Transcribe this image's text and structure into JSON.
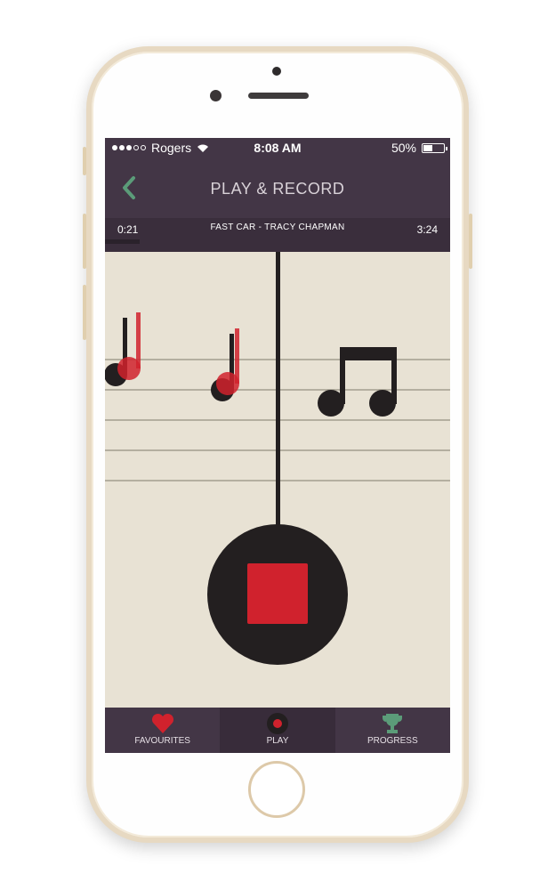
{
  "status_bar": {
    "carrier": "Rogers",
    "time": "8:08 AM",
    "battery_percent": "50%",
    "battery_level": 0.5
  },
  "nav": {
    "title": "PLAY & RECORD",
    "back_icon": "chevron-left-icon"
  },
  "track": {
    "current_time": "0:21",
    "name": "FAST CAR - TRACY CHAPMAN",
    "total_time": "3:24",
    "progress": 0.1
  },
  "colors": {
    "header": "#433646",
    "accent_red": "#d0222d",
    "back_green": "#5b9c79",
    "paper": "#e8e2d4",
    "ink": "#231f20"
  },
  "record_control": {
    "icon": "stop-icon"
  },
  "tabs": [
    {
      "label": "FAVOURITES",
      "icon": "heart-icon",
      "active": false
    },
    {
      "label": "PLAY",
      "icon": "record-icon",
      "active": true
    },
    {
      "label": "PROGRESS",
      "icon": "trophy-icon",
      "active": false
    }
  ]
}
